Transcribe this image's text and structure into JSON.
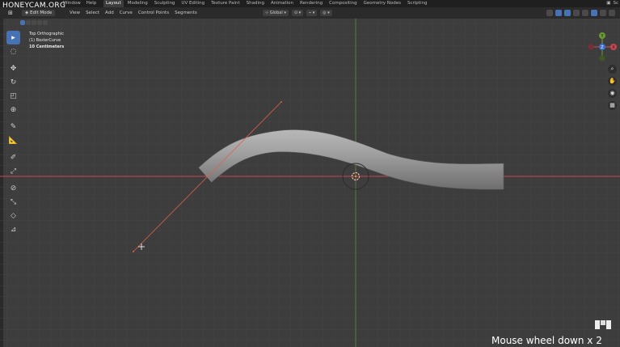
{
  "watermark": "HONEYCAM.ORG",
  "topbar": {
    "menus": [
      "Window",
      "Help"
    ],
    "workspaces": [
      "Layout",
      "Modeling",
      "Sculpting",
      "UV Editing",
      "Texture Paint",
      "Shading",
      "Animation",
      "Rendering",
      "Compositing",
      "Geometry Nodes",
      "Scripting"
    ],
    "active_workspace": "Layout",
    "scene_label": "Sc"
  },
  "header": {
    "mode": "Edit Mode",
    "menus": [
      "View",
      "Select",
      "Add",
      "Curve",
      "Control Points",
      "Segments"
    ],
    "orientation": "Global"
  },
  "viewport_info": {
    "view": "Top Orthographic",
    "object": "(1) BezierCurve",
    "scale": "10 Centimeters"
  },
  "tools": [
    "select-box",
    "cursor",
    "move",
    "rotate",
    "scale",
    "transform",
    "annotate",
    "measure",
    "draw",
    "extrude",
    "radius",
    "tilt",
    "randomize",
    "shear"
  ],
  "gizmo_axes": {
    "x": "X",
    "y": "Y",
    "z": "Z"
  },
  "colors": {
    "x_axis": "#c7474f",
    "y_axis": "#6a9a36",
    "curve": "#9c9c9c",
    "accent": "#4772b3",
    "handle": "#e0604a"
  },
  "caption": "Mouse wheel down x 2"
}
